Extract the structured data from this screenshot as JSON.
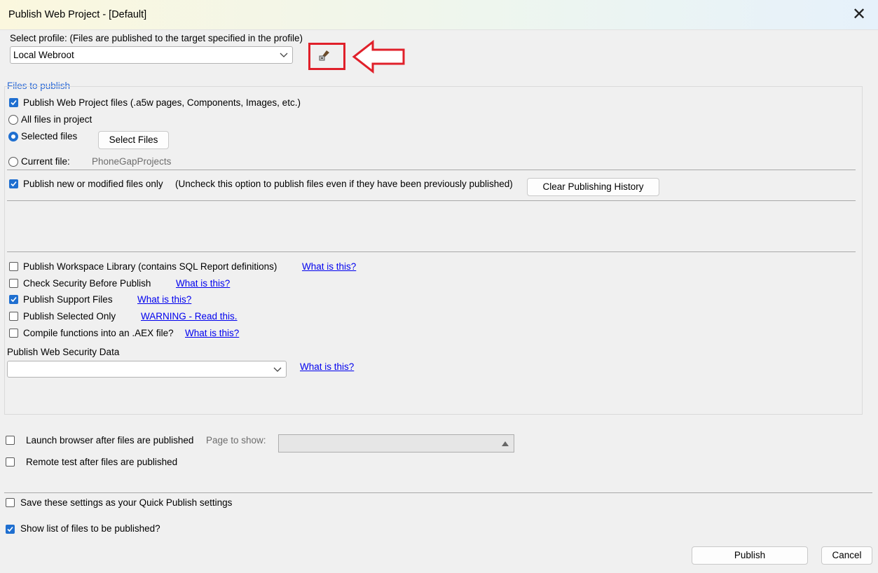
{
  "window": {
    "title": "Publish Web Project - [Default]"
  },
  "profile": {
    "label": "Select profile: (Files are published to the target specified in the profile)",
    "value": "Local Webroot"
  },
  "files_group": {
    "title": "Files to publish",
    "publish_project_files": {
      "label": "Publish Web Project files (.a5w pages, Components, Images, etc.)",
      "checked": true
    },
    "all_files": {
      "label": "All files in project"
    },
    "selected_files": {
      "label": "Selected files",
      "checked": true
    },
    "select_files_button": "Select Files",
    "current_file": {
      "label": "Current file:",
      "value": "PhoneGapProjects"
    },
    "new_modified_only": {
      "label": "Publish new or modified files only",
      "checked": true
    },
    "new_modified_hint": "(Uncheck this option to publish files even if they have been previously published)",
    "clear_history_button": "Clear Publishing History",
    "workspace_library": {
      "label": "Publish Workspace Library (contains SQL Report definitions)",
      "link": "What is this?"
    },
    "check_security": {
      "label": "Check Security Before Publish",
      "link": "What is this?"
    },
    "support_files": {
      "label": "Publish Support Files",
      "link": "What is this?",
      "checked": true
    },
    "selected_only": {
      "label": "Publish Selected Only",
      "link": "WARNING - Read this."
    },
    "compile_functions": {
      "label": "Compile functions into an .AEX file?",
      "link": "What is this?"
    },
    "security_data": {
      "label": "Publish Web Security Data",
      "value": "",
      "link": "What is this?"
    }
  },
  "launch": {
    "label": "Launch browser after files are published",
    "page_label": "Page to show:",
    "page_value": ""
  },
  "remote_test": {
    "label": "Remote test after files are published"
  },
  "quick_publish": {
    "label": "Save these settings as your Quick Publish settings"
  },
  "show_list": {
    "label": "Show list of files to be published?",
    "checked": true
  },
  "buttons": {
    "publish": "Publish",
    "cancel": "Cancel"
  },
  "annotation": {
    "color": "#e0202a"
  },
  "colors": {
    "accent": "#1f6fd0",
    "link": "#0000ee"
  }
}
